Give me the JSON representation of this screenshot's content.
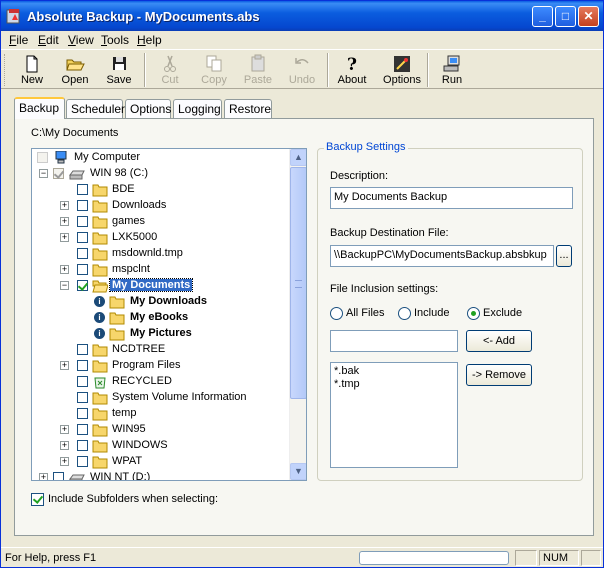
{
  "window": {
    "title": "Absolute Backup - MyDocuments.abs",
    "controls": [
      "_",
      "□",
      "✕"
    ]
  },
  "menu": [
    {
      "label": "File",
      "underline": "F",
      "rest": "ile"
    },
    {
      "label": "Edit",
      "underline": "E",
      "rest": "dit"
    },
    {
      "label": "View",
      "underline": "V",
      "rest": "iew"
    },
    {
      "label": "Tools",
      "underline": "T",
      "rest": "ools"
    },
    {
      "label": "Help",
      "underline": "H",
      "rest": "elp"
    }
  ],
  "toolbar": {
    "new": "New",
    "open": "Open",
    "save": "Save",
    "cut": "Cut",
    "copy": "Copy",
    "paste": "Paste",
    "undo": "Undo",
    "about": "About",
    "options": "Options",
    "run": "Run"
  },
  "tabs": [
    "Backup",
    "Scheduler",
    "Options",
    "Logging",
    "Restore"
  ],
  "current_path": "C:\\My Documents",
  "tree": {
    "root": "My Computer",
    "drive_c": "WIN 98 (C:)",
    "items": [
      "BDE",
      "Downloads",
      "games",
      "LXK5000",
      "msdownld.tmp",
      "mspclnt",
      "My Documents",
      "My Downloads",
      "My eBooks",
      "My Pictures",
      "NCDTREE",
      "Program Files",
      "RECYCLED",
      "System Volume Information",
      "temp",
      "WIN95",
      "WINDOWS",
      "WPAT"
    ],
    "drive_d": "WIN NT (D:)"
  },
  "settings": {
    "group_title": "Backup Settings",
    "description_label": "Description:",
    "description_value": "My Documents Backup",
    "destination_label": "Backup Destination File:",
    "destination_value": "\\\\BackupPC\\MyDocumentsBackup.absbkup",
    "browse_label": "...",
    "inclusion_label": "File Inclusion settings:",
    "radio_all": "All Files",
    "radio_include": "Include",
    "radio_exclude": "Exclude",
    "selected_mode": "Exclude",
    "pattern_input": "",
    "add_label": "<- Add",
    "remove_label": "-> Remove",
    "patterns": [
      "*.bak",
      "*.tmp"
    ]
  },
  "include_subfolders_label": "Include Subfolders when selecting:",
  "status": {
    "help": "For Help, press F1",
    "num": "NUM"
  }
}
